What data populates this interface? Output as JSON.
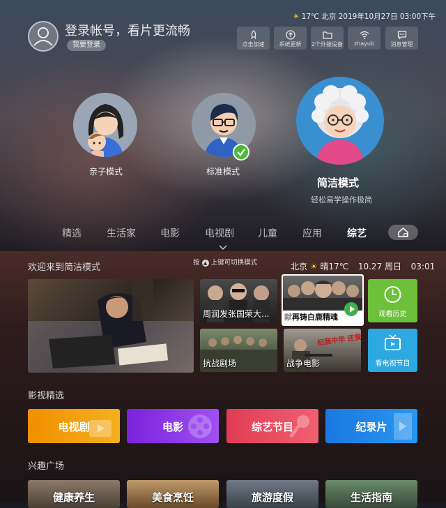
{
  "header": {
    "login_prompt": "登录帐号，看片更流畅",
    "login_button": "我要登录",
    "status": "17℃ 北京 2019年10月27日 03:00下午",
    "toolbar": [
      {
        "label": "点击加速",
        "icon": "rocket-icon"
      },
      {
        "label": "系统更新",
        "icon": "upload-icon"
      },
      {
        "label": "2个外接设备",
        "icon": "folder-icon"
      },
      {
        "label": "zhayub",
        "icon": "wifi-icon"
      },
      {
        "label": "消息管理",
        "icon": "message-icon"
      }
    ]
  },
  "modes": {
    "parent_child": "亲子模式",
    "standard": "标准模式",
    "simple": "简洁模式",
    "simple_desc": "轻松易学操作极简"
  },
  "nav": {
    "tabs": [
      "精选",
      "生活家",
      "电影",
      "电视剧",
      "儿童",
      "应用",
      "综艺"
    ],
    "active": "综艺",
    "home_icon": "home-icon"
  },
  "welcome": {
    "title": "欢迎来到简洁模式",
    "hint": "按",
    "hint_rest": "上键可切换模式",
    "location": "北京",
    "weather": "晴17℃",
    "date": "10.27 周日",
    "time": "03:01"
  },
  "featured": {
    "tile1": "周润发张国荣大...",
    "tile2": "再铸白鹿精魂",
    "tile2_prefix": "献",
    "tile3": "抗战剧场",
    "tile4": "战争电影",
    "tile4_banner": "纪我中华 还我山河",
    "history": "观看历史",
    "tv_guide": "看电视节目"
  },
  "film_section": {
    "title": "影视精选",
    "categories": [
      {
        "label": "电视剧",
        "color": "#f0a000"
      },
      {
        "label": "电影",
        "color": "#8a2be2"
      },
      {
        "label": "综艺节目",
        "color": "#e8455c"
      },
      {
        "label": "纪录片",
        "color": "#1e88e5"
      }
    ]
  },
  "interest_section": {
    "title": "兴趣广场",
    "items": [
      "健康养生",
      "美食烹饪",
      "旅游度假",
      "生活指南"
    ]
  }
}
